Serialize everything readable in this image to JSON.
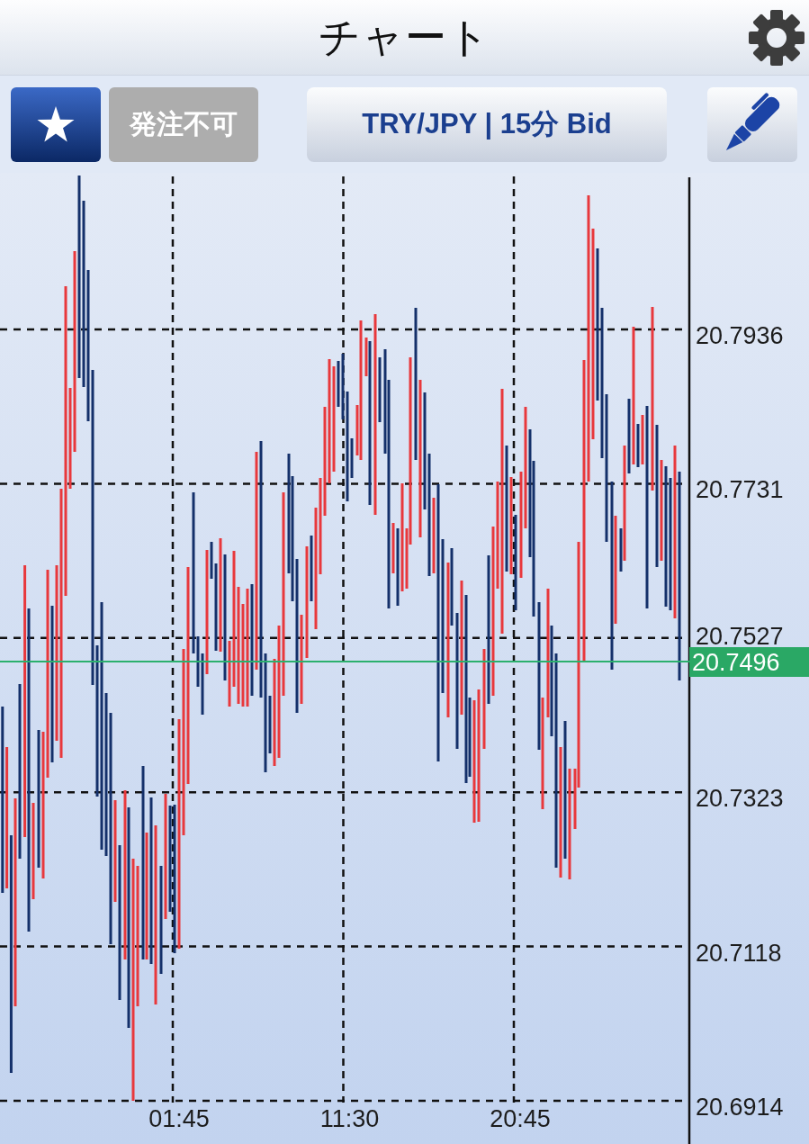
{
  "header": {
    "title": "チャート"
  },
  "toolbar": {
    "order_button": {
      "label": "発注不可",
      "disabled": true
    },
    "symbol_button": {
      "label": "TRY/JPY | 15分 Bid"
    }
  },
  "chart": {
    "price_labels": [
      "20.7936",
      "20.7731",
      "20.7527",
      "20.7323",
      "20.7118",
      "20.6914"
    ],
    "time_labels": [
      "01:45",
      "11:30",
      "20:45"
    ],
    "current_price": "20.7496"
  }
}
